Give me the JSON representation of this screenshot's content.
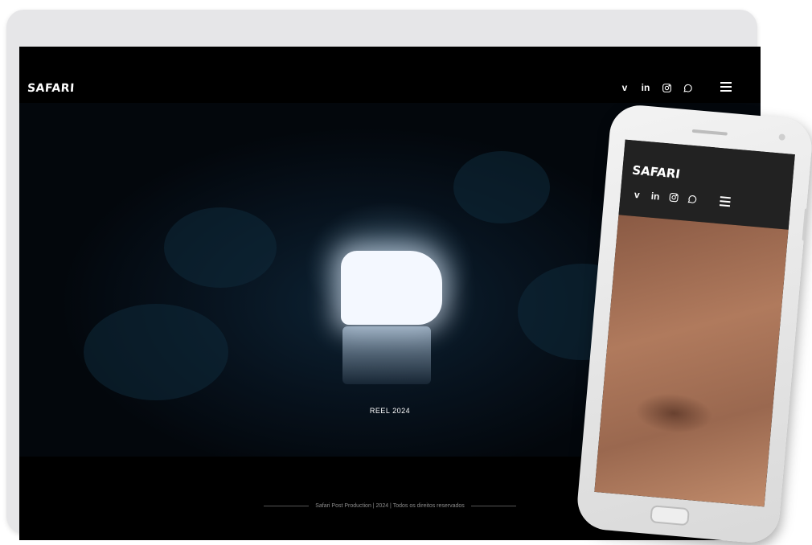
{
  "desktop": {
    "header": {
      "logo": "SAFARI",
      "socials": [
        {
          "icon": "vimeo-icon",
          "glyph": "v"
        },
        {
          "icon": "linkedin-icon",
          "glyph": "in"
        },
        {
          "icon": "instagram-icon"
        },
        {
          "icon": "whatsapp-icon"
        }
      ],
      "menu_icon": "hamburger-menu-icon"
    },
    "hero": {
      "label": "REEL 2024"
    },
    "footer": {
      "text": "Safari Post Production | 2024 | Todos os direitos reservados"
    }
  },
  "mobile": {
    "header": {
      "logo": "SAFARI",
      "socials": [
        {
          "icon": "vimeo-icon",
          "glyph": "v"
        },
        {
          "icon": "linkedin-icon",
          "glyph": "in"
        },
        {
          "icon": "instagram-icon"
        },
        {
          "icon": "whatsapp-icon"
        }
      ],
      "menu_icon": "hamburger-menu-icon"
    }
  },
  "colors": {
    "background": "#000000",
    "text": "#ffffff",
    "footer_text": "#8d8d8d"
  }
}
